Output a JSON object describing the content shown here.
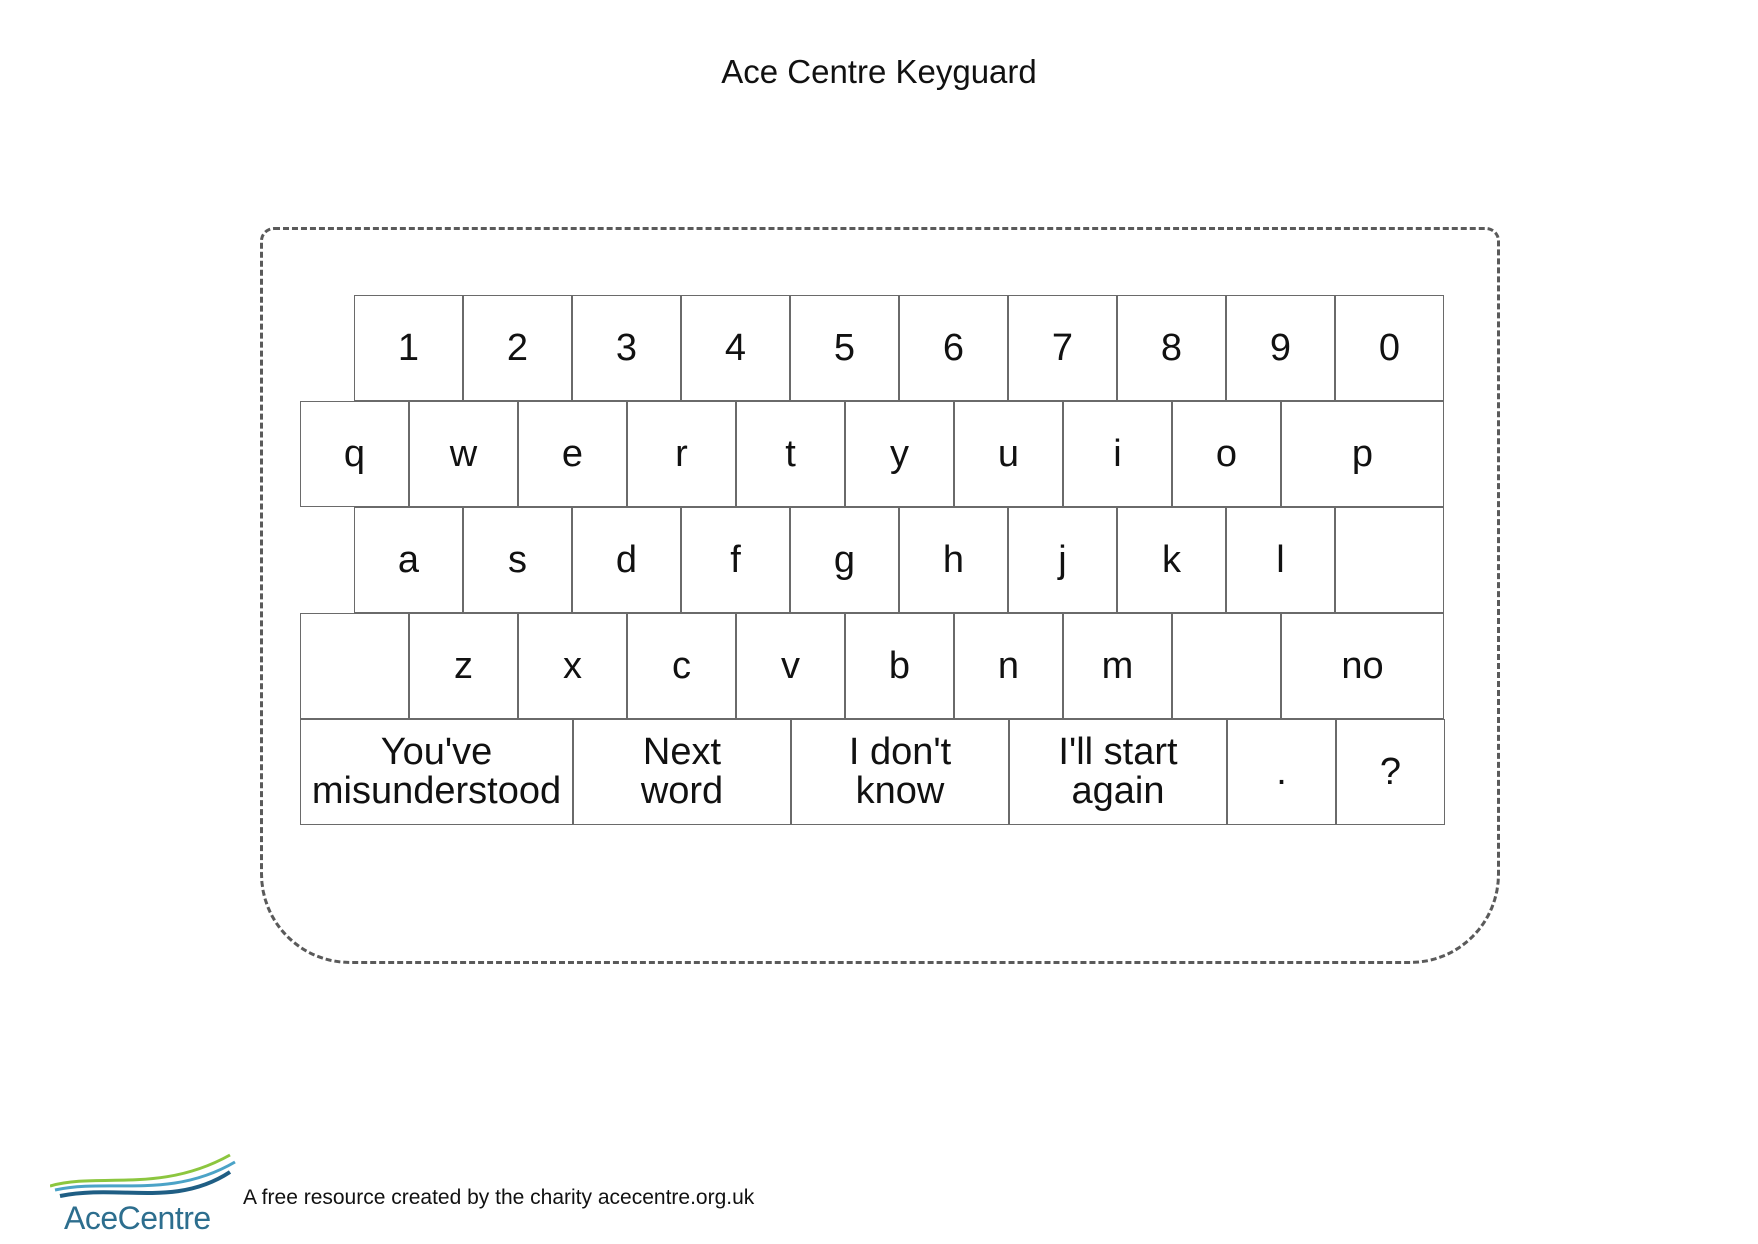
{
  "document": {
    "title": "Ace Centre Keyguard"
  },
  "keyboard": {
    "rows": [
      [
        "1",
        "2",
        "3",
        "4",
        "5",
        "6",
        "7",
        "8",
        "9",
        "0"
      ],
      [
        "q",
        "w",
        "e",
        "r",
        "t",
        "y",
        "u",
        "i",
        "o",
        "p"
      ],
      [
        "a",
        "s",
        "d",
        "f",
        "g",
        "h",
        "j",
        "k",
        "l",
        ""
      ],
      [
        "",
        "z",
        "x",
        "c",
        "v",
        "b",
        "n",
        "m",
        "",
        "no"
      ],
      [
        "You've\nmisunderstood",
        "Next\nword",
        "I don't\nknow",
        "I'll start\nagain",
        ".",
        "?"
      ]
    ]
  },
  "footer": {
    "logo_text": "AceCentre",
    "text": "A free resource created by the charity acecentre.org.uk",
    "logo_colors": [
      "#8cc63f",
      "#4ba3c7",
      "#1f5e84"
    ]
  }
}
